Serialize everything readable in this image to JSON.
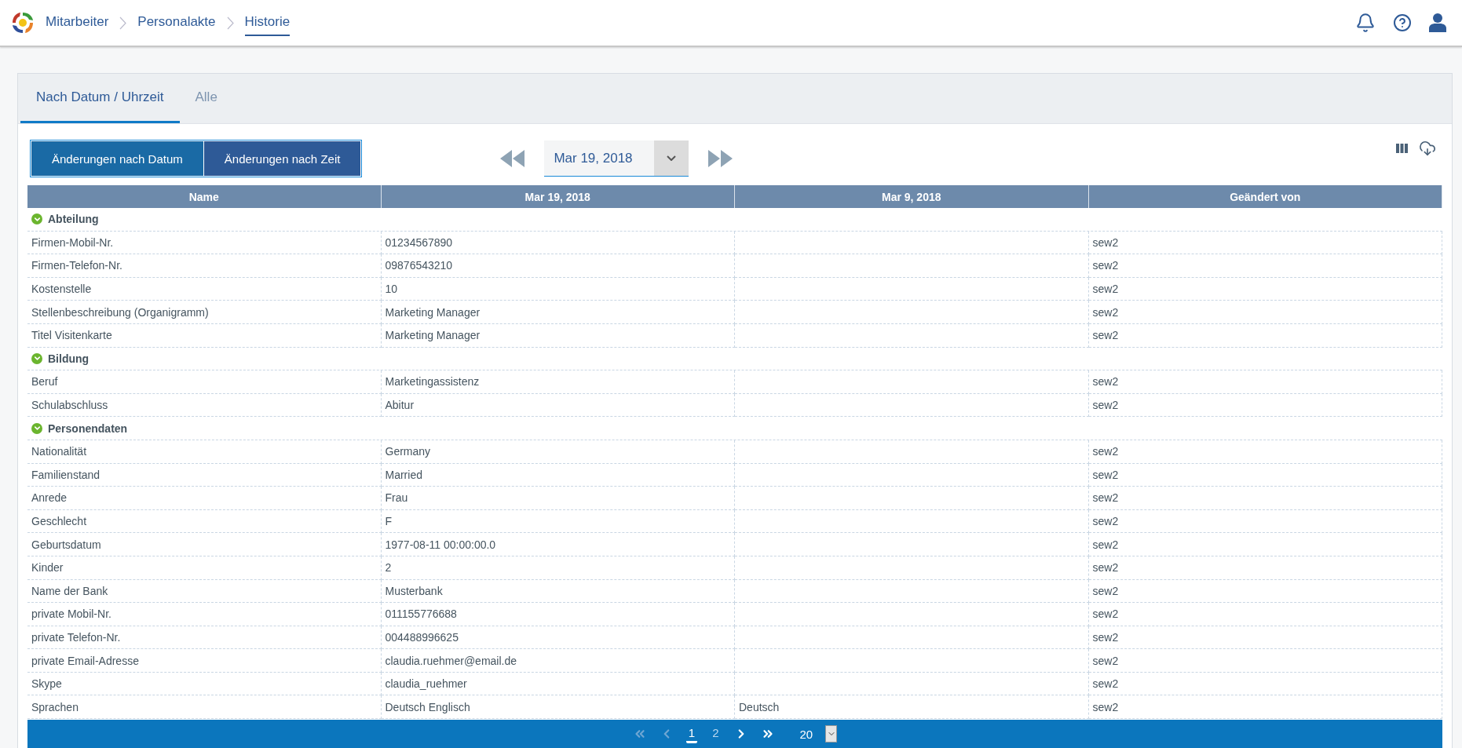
{
  "header": {
    "breadcrumbs": [
      {
        "label": "Mitarbeiter",
        "selected": false
      },
      {
        "label": "Personalakte",
        "selected": false
      },
      {
        "label": "Historie",
        "selected": true
      }
    ]
  },
  "tabs": [
    {
      "label": "Nach Datum / Uhrzeit",
      "selected": true
    },
    {
      "label": "Alle",
      "selected": false
    }
  ],
  "view_buttons": [
    {
      "label": "Änderungen nach Datum",
      "selected": true
    },
    {
      "label": "Änderungen nach Zeit",
      "selected": false
    }
  ],
  "date_picker": {
    "value": "Mar 19, 2018"
  },
  "table": {
    "columns": [
      "Name",
      "Mar 19, 2018",
      "Mar 9, 2018",
      "Geändert von"
    ],
    "groups": [
      {
        "name": "Abteilung",
        "expanded": true,
        "rows": [
          {
            "name": "Firmen-Mobil-Nr.",
            "date_1": "01234567890",
            "changed_by": "sew2"
          },
          {
            "name": "Firmen-Telefon-Nr.",
            "date_1": "09876543210",
            "changed_by": "sew2"
          },
          {
            "name": "Kostenstelle",
            "date_1": "10",
            "changed_by": "sew2"
          },
          {
            "name": "Stellenbeschreibung (Organigramm)",
            "date_1": "Marketing Manager",
            "changed_by": "sew2"
          },
          {
            "name": "Titel Visitenkarte",
            "date_1": "Marketing Manager",
            "changed_by": "sew2"
          }
        ]
      },
      {
        "name": "Bildung",
        "expanded": true,
        "rows": [
          {
            "name": "Beruf",
            "date_1": "Marketingassistenz",
            "changed_by": "sew2"
          },
          {
            "name": "Schulabschluss",
            "date_1": "Abitur",
            "changed_by": "sew2"
          }
        ]
      },
      {
        "name": "Personendaten",
        "expanded": true,
        "rows": [
          {
            "name": "Nationalität",
            "date_1": "Germany",
            "changed_by": "sew2"
          },
          {
            "name": "Familienstand",
            "date_1": "Married",
            "changed_by": "sew2"
          },
          {
            "name": "Anrede",
            "date_1": "Frau",
            "changed_by": "sew2"
          },
          {
            "name": "Geschlecht",
            "date_1": "F",
            "changed_by": "sew2"
          },
          {
            "name": "Geburtsdatum",
            "date_1": "1977-08-11 00:00:00.0",
            "changed_by": "sew2"
          },
          {
            "name": "Kinder",
            "date_1": "2",
            "changed_by": "sew2"
          },
          {
            "name": "Name der Bank",
            "date_1": "Musterbank",
            "changed_by": "sew2"
          },
          {
            "name": "private Mobil-Nr.",
            "date_1": "011155776688",
            "changed_by": "sew2"
          },
          {
            "name": "private Telefon-Nr.",
            "date_1": "004488996625",
            "changed_by": "sew2"
          },
          {
            "name": "private Email-Adresse",
            "date_1": "claudia.ruehmer@email.de",
            "changed_by": "sew2"
          },
          {
            "name": "Skype",
            "date_1": "claudia_ruehmer",
            "changed_by": "sew2"
          },
          {
            "name": "Sprachen",
            "date_1": "Deutsch Englisch",
            "date_2": "Deutsch",
            "changed_by": "sew2"
          }
        ]
      }
    ]
  },
  "pagination": {
    "first_disabled": true,
    "prev_disabled": true,
    "pages": [
      {
        "label": "1",
        "selected": true
      },
      {
        "label": "2",
        "selected": false
      }
    ],
    "page_size": "20"
  }
}
